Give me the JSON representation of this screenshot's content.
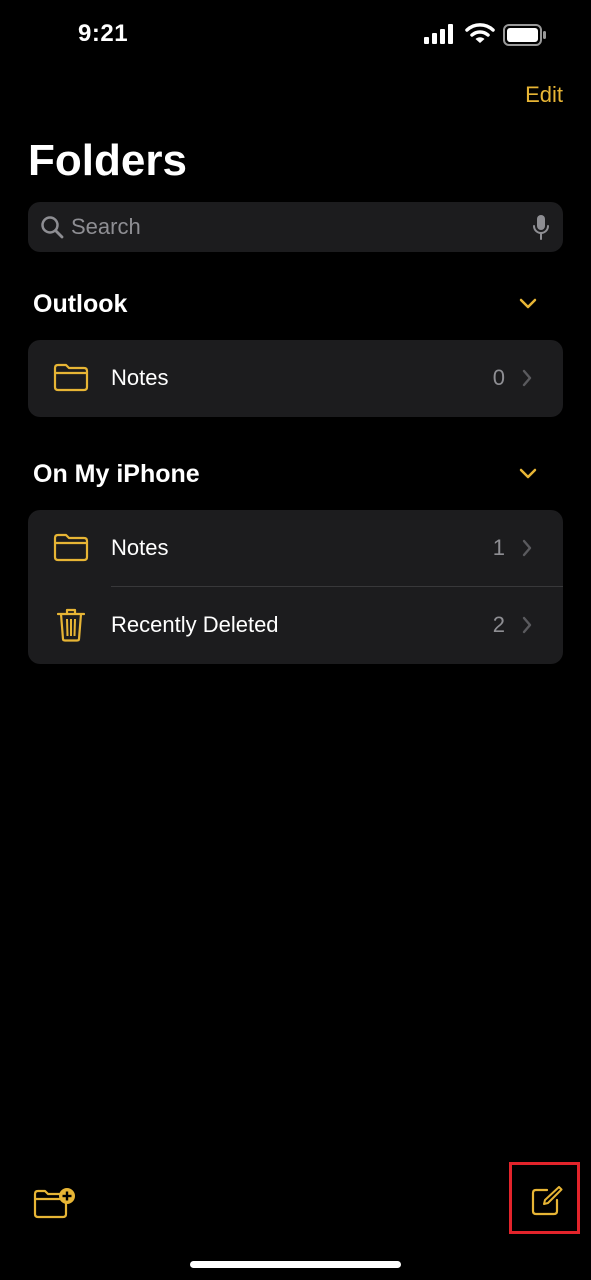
{
  "status_bar": {
    "time": "9:21",
    "icons": [
      "cellular-signal-icon",
      "wifi-icon",
      "battery-icon"
    ]
  },
  "header": {
    "edit_label": "Edit",
    "title": "Folders"
  },
  "search": {
    "placeholder": "Search",
    "value": "",
    "icons": [
      "search-icon",
      "microphone-icon"
    ]
  },
  "sections": [
    {
      "title": "Outlook",
      "collapse_icon": "chevron-down-icon",
      "items": [
        {
          "label": "Notes",
          "count": "0",
          "icon": "folder-icon"
        }
      ]
    },
    {
      "title": "On My iPhone",
      "collapse_icon": "chevron-down-icon",
      "items": [
        {
          "label": "Notes",
          "count": "1",
          "icon": "folder-icon"
        },
        {
          "label": "Recently Deleted",
          "count": "2",
          "icon": "trash-icon"
        }
      ]
    }
  ],
  "toolbar": {
    "left_icon": "new-folder-icon",
    "right_icon": "compose-icon"
  },
  "colors": {
    "accent": "#e7b535",
    "background": "#000000",
    "group_background": "#1c1c1e",
    "secondary_text": "#8e8e93",
    "highlight_box": "#e3242b"
  }
}
